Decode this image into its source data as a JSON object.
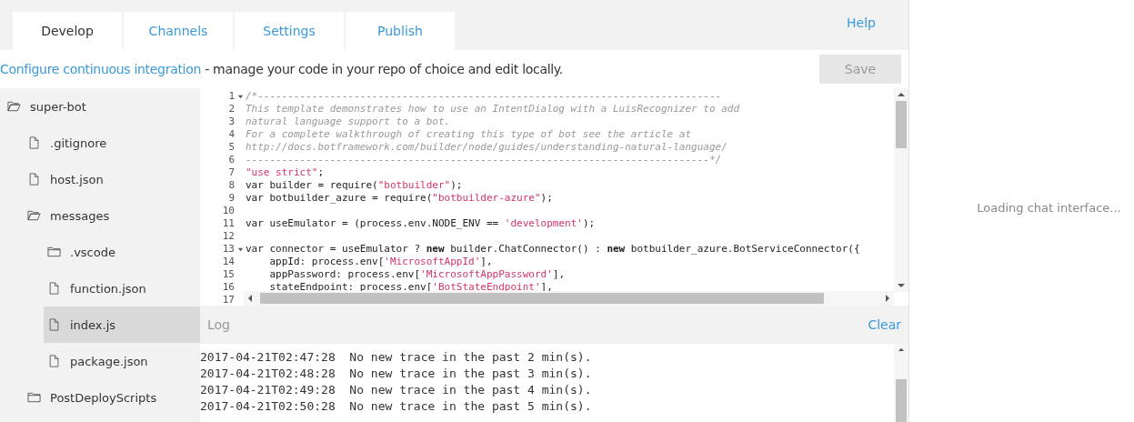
{
  "tabs": [
    {
      "label": "Develop",
      "selected": true
    },
    {
      "label": "Channels",
      "selected": false
    },
    {
      "label": "Settings",
      "selected": false
    },
    {
      "label": "Publish",
      "selected": false
    }
  ],
  "help_link": "Help",
  "info_bar": {
    "link": "Configure continuous integration",
    "text": " - manage your code in your repo of choice and edit locally.",
    "save_button": {
      "label": "Save",
      "disabled": true
    }
  },
  "file_tree": [
    {
      "name": "super-bot",
      "kind": "folder",
      "expanded": true,
      "selected": false,
      "children": [
        {
          "name": ".gitignore",
          "kind": "file",
          "selected": false
        },
        {
          "name": "host.json",
          "kind": "file",
          "selected": false
        },
        {
          "name": "messages",
          "kind": "folder",
          "expanded": true,
          "selected": false,
          "children": [
            {
              "name": ".vscode",
              "kind": "folder",
              "expanded": false,
              "selected": false
            },
            {
              "name": "function.json",
              "kind": "file",
              "selected": false
            },
            {
              "name": "index.js",
              "kind": "file",
              "selected": true
            },
            {
              "name": "package.json",
              "kind": "file",
              "selected": false
            }
          ]
        },
        {
          "name": "PostDeployScripts",
          "kind": "folder",
          "expanded": false,
          "selected": false
        }
      ]
    }
  ],
  "editor": {
    "lines": [
      {
        "number": "1",
        "foldable": true,
        "segments": [
          {
            "kind": "comment",
            "text": "/*-----------------------------------------------------------------------------"
          }
        ]
      },
      {
        "number": "2",
        "foldable": false,
        "segments": [
          {
            "kind": "comment",
            "text": "This template demonstrates how to use an IntentDialog with a LuisRecognizer to add"
          }
        ]
      },
      {
        "number": "3",
        "foldable": false,
        "segments": [
          {
            "kind": "comment",
            "text": "natural language support to a bot."
          }
        ]
      },
      {
        "number": "4",
        "foldable": false,
        "segments": [
          {
            "kind": "comment",
            "text": "For a complete walkthrough of creating this type of bot see the article at"
          }
        ]
      },
      {
        "number": "5",
        "foldable": false,
        "segments": [
          {
            "kind": "comment",
            "text": "http://docs.botframework.com/builder/node/guides/understanding-natural-language/"
          }
        ]
      },
      {
        "number": "6",
        "foldable": false,
        "segments": [
          {
            "kind": "comment",
            "text": "-----------------------------------------------------------------------------*/"
          }
        ]
      },
      {
        "number": "7",
        "foldable": false,
        "segments": [
          {
            "kind": "string",
            "text": "\"use strict\""
          },
          {
            "kind": "text",
            "text": ";"
          }
        ]
      },
      {
        "number": "8",
        "foldable": false,
        "segments": [
          {
            "kind": "text",
            "text": "var builder = require("
          },
          {
            "kind": "string",
            "text": "\"botbuilder\""
          },
          {
            "kind": "text",
            "text": ");"
          }
        ]
      },
      {
        "number": "9",
        "foldable": false,
        "segments": [
          {
            "kind": "text",
            "text": "var botbuilder_azure = require("
          },
          {
            "kind": "string",
            "text": "\"botbuilder-azure\""
          },
          {
            "kind": "text",
            "text": ");"
          }
        ]
      },
      {
        "number": "10",
        "foldable": false
      },
      {
        "number": "11",
        "foldable": false,
        "segments": [
          {
            "kind": "text",
            "text": "var useEmulator = (process.env.NODE_ENV == "
          },
          {
            "kind": "string",
            "text": "'development'"
          },
          {
            "kind": "text",
            "text": ");"
          }
        ]
      },
      {
        "number": "12",
        "foldable": false
      },
      {
        "number": "13",
        "foldable": true,
        "segments": [
          {
            "kind": "text",
            "text": "var connector = useEmulator ? "
          },
          {
            "kind": "keyword",
            "text": "new"
          },
          {
            "kind": "text",
            "text": " builder.ChatConnector() : "
          },
          {
            "kind": "keyword",
            "text": "new"
          },
          {
            "kind": "text",
            "text": " botbuilder_azure.BotServiceConnector({"
          }
        ]
      },
      {
        "number": "14",
        "foldable": false,
        "segments": [
          {
            "kind": "text",
            "text": "    appId: process.env["
          },
          {
            "kind": "string",
            "text": "'MicrosoftAppId'"
          },
          {
            "kind": "text",
            "text": "],"
          }
        ]
      },
      {
        "number": "15",
        "foldable": false,
        "segments": [
          {
            "kind": "text",
            "text": "    appPassword: process.env["
          },
          {
            "kind": "string",
            "text": "'MicrosoftAppPassword'"
          },
          {
            "kind": "text",
            "text": "],"
          }
        ]
      },
      {
        "number": "16",
        "foldable": false,
        "segments": [
          {
            "kind": "text",
            "text": "    stateEndpoint: process.env["
          },
          {
            "kind": "string",
            "text": "'BotStateEndpoint'"
          },
          {
            "kind": "text",
            "text": "],"
          }
        ]
      },
      {
        "number": "17",
        "foldable": false
      }
    ]
  },
  "log": {
    "title": "Log",
    "clear_button": "Clear",
    "lines": [
      "2017-04-21T02:47:28  No new trace in the past 2 min(s).",
      "2017-04-21T02:48:28  No new trace in the past 3 min(s).",
      "2017-04-21T02:49:28  No new trace in the past 4 min(s).",
      "2017-04-21T02:50:28  No new trace in the past 5 min(s)."
    ]
  },
  "chat_panel": {
    "status": "Loading chat interface..."
  }
}
